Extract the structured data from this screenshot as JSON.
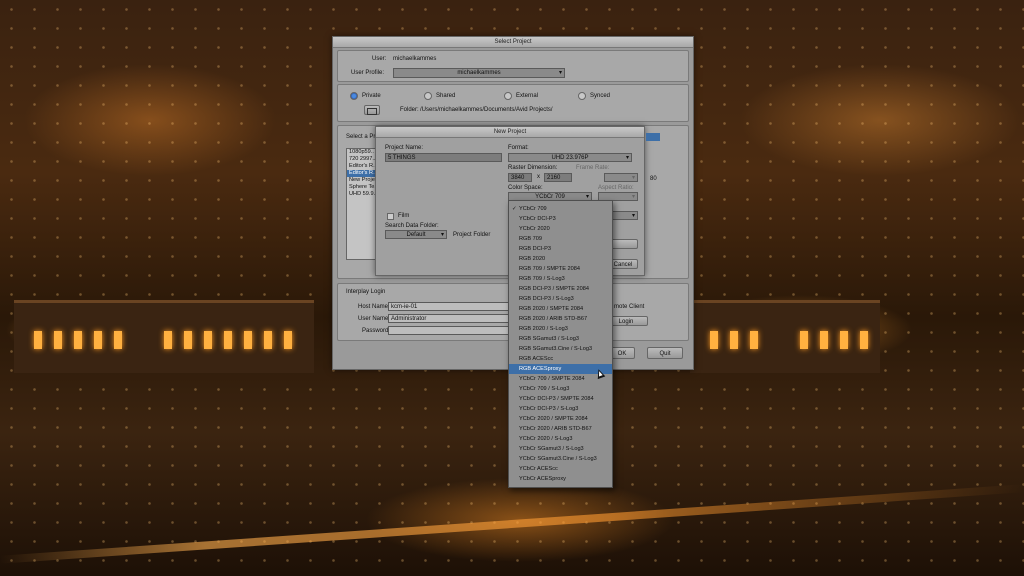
{
  "select_project": {
    "title": "Select Project",
    "user_label": "User:",
    "user_value": "michaelkammes",
    "user_profile_label": "User Profile:",
    "user_profile_value": "michaelkammes",
    "radios": [
      "Private",
      "Shared",
      "External",
      "Synced"
    ],
    "selected_radio": "Private",
    "folder_label": "Folder:",
    "folder_value": "/Users/michaelkammes/Documents/Avid Projects/",
    "select_project_label": "Select a Pro",
    "project_list": [
      "1080p59..",
      "720 2997..",
      "Editor's R..",
      "Editor's R..",
      "New Proje..",
      "Sphere Te..",
      "UHD 59.9.."
    ],
    "interplay_login_label": "Interplay Login",
    "host_name_label": "Host Name:",
    "host_name_value": "kcm-ie-01",
    "user_name_label": "User Name:",
    "user_name_value": "Administrator",
    "password_label": "Password:",
    "remote_client_label": "mote Client",
    "login_button": "Login",
    "ok_button": "OK",
    "quit_button": "Quit",
    "stray_label": "80"
  },
  "new_project": {
    "title": "New Project",
    "project_name_label": "Project Name:",
    "project_name_value": "5 THINGS",
    "format_label": "Format:",
    "format_value": "UHD 23.976P",
    "raster_label": "Raster Dimension:",
    "raster_width": "3840",
    "raster_x": "x",
    "raster_height": "2160",
    "frame_rate_label": "Frame Rate:",
    "color_space_label": "Color Space:",
    "color_space_value": "YCbCr 709",
    "aspect_ratio_label": "Aspect Ratio:",
    "film_label": "Film",
    "search_data_folder_label": "Search Data Folder:",
    "search_data_folder_value": "Default",
    "project_folder_label": "Project Folder",
    "cancel_button": "Cancel"
  },
  "color_space_menu": {
    "checked_item": "YCbCr 709",
    "highlighted_item": "RGB ACESproxy",
    "items": [
      "YCbCr 709",
      "YCbCr DCI-P3",
      "YCbCr 2020",
      "RGB 709",
      "RGB DCI-P3",
      "RGB 2020",
      "RGB 709 / SMPTE 2084",
      "RGB 709 / S-Log3",
      "RGB DCI-P3 / SMPTE 2084",
      "RGB DCI-P3 / S-Log3",
      "RGB 2020 / SMPTE 2084",
      "RGB 2020 / ARIB STD-B67",
      "RGB 2020 / S-Log3",
      "RGB SGamut3 / S-Log3",
      "RGB SGamut3.Cine / S-Log3",
      "RGB ACEScc",
      "RGB ACESproxy",
      "YCbCr 709 / SMPTE 2084",
      "YCbCr 709 / S-Log3",
      "YCbCr DCI-P3 / SMPTE 2084",
      "YCbCr DCI-P3 / S-Log3",
      "YCbCr 2020 / SMPTE 2084",
      "YCbCr 2020 / ARIB STD-B67",
      "YCbCr 2020 / S-Log3",
      "YCbCr SGamut3 / S-Log3",
      "YCbCr SGamut3.Cine / S-Log3",
      "YCbCr ACEScc",
      "YCbCr ACESproxy"
    ]
  },
  "colors": {
    "highlight": "#3d6fa8",
    "dialog_gray": "#9a9a9a"
  }
}
